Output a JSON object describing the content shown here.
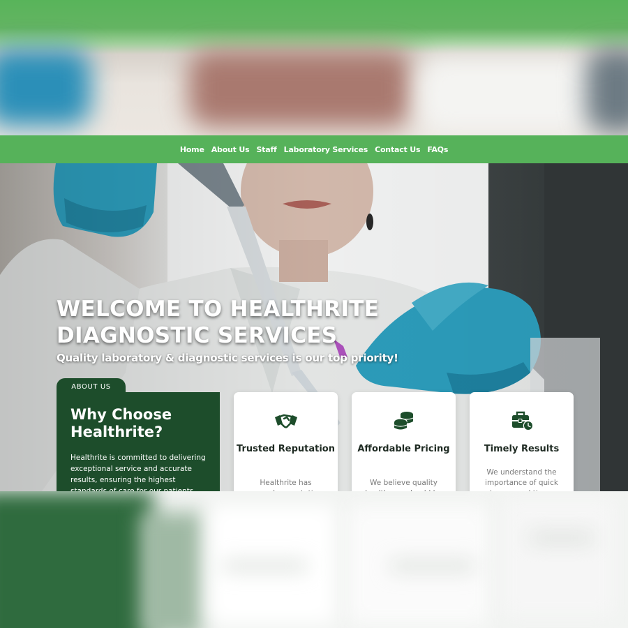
{
  "nav": {
    "items": [
      "Home",
      "About Us",
      "Staff",
      "Laboratory Services",
      "Contact Us",
      "FAQs"
    ]
  },
  "hero": {
    "title": "WELCOME TO HEALTHRITE DIAGNOSTIC SERVICES",
    "subtitle": "Quality laboratory & diagnostic services is our top priority!"
  },
  "about": {
    "tab_label": "ABOUT US",
    "title": "Why Choose Healthrite?",
    "text": "Healthrite is committed to delivering exceptional service and accurate results, ensuring the highest standards of care for our patients. We offer a wide"
  },
  "features": [
    {
      "icon": "handshake-icon",
      "title": "Trusted Reputation",
      "text": "Healthrite has earned a reputation for"
    },
    {
      "icon": "coins-icon",
      "title": "Affordable Pricing",
      "text": "We believe quality healthcare should be"
    },
    {
      "icon": "briefcase-clock-icon",
      "title": "Timely Results",
      "text": "We understand the importance of quick turnaround times"
    }
  ],
  "colors": {
    "brand_green": "#56b25a",
    "dark_green": "#1d4d2b",
    "glove_blue": "#2aa0bf"
  }
}
